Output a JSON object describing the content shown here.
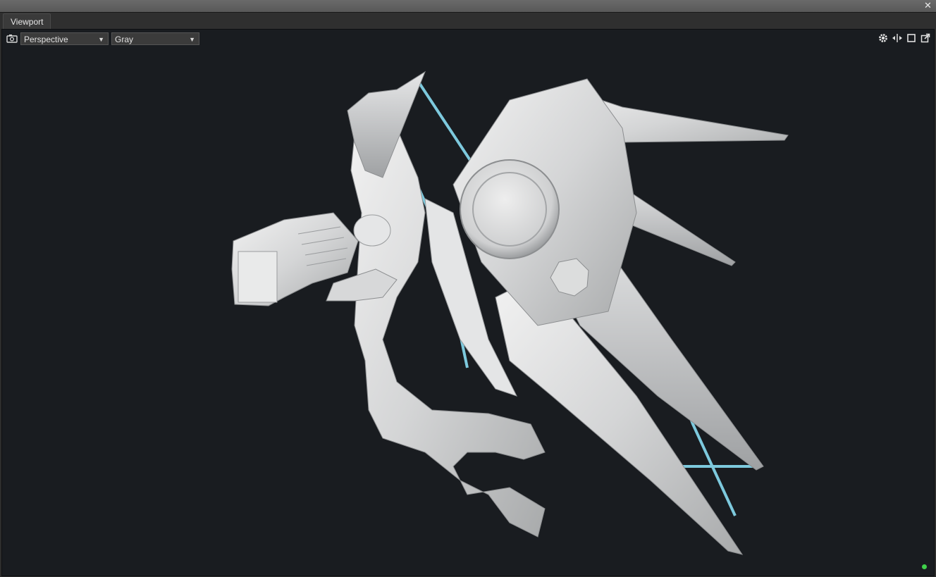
{
  "panel": {
    "tab_label": "Viewport",
    "close_icon": "close-icon"
  },
  "toolbar": {
    "camera_icon": "camera-icon",
    "projection": {
      "selected": "Perspective",
      "options_visible": [
        "Perspective"
      ]
    },
    "shading": {
      "selected": "Gray",
      "options_visible": [
        "Gray"
      ]
    },
    "right_icons": [
      "gear-icon",
      "move-arrows-icon",
      "maximize-square-icon",
      "external-link-icon"
    ]
  },
  "viewport": {
    "background_color": "#191c20",
    "model_color": "#d9dadb",
    "rim_light_color": "#8fe8ff",
    "status_indicator_color": "#3fd14a"
  }
}
